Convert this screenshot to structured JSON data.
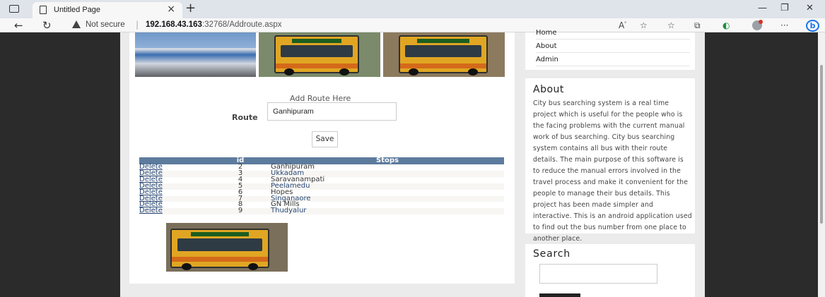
{
  "browser": {
    "tab_title": "Untitled Page",
    "tab_close": "×",
    "new_tab": "+",
    "not_secure": "Not secure",
    "separator": "|",
    "url_host": "192.168.43.163",
    "url_path": ":32768/Addroute.aspx"
  },
  "menu": {
    "items": [
      {
        "label": "Home"
      },
      {
        "label": "About"
      },
      {
        "label": "Admin"
      }
    ]
  },
  "form": {
    "title": "Add Route Here",
    "route_label": "Route",
    "route_value": "Ganhipuram",
    "save_label": "Save"
  },
  "grid": {
    "columns": [
      "",
      "id",
      "Stops"
    ],
    "delete_label": "Delete",
    "rows": [
      {
        "id": "2",
        "stop": "Ganhipuram"
      },
      {
        "id": "3",
        "stop": "Ukkadam"
      },
      {
        "id": "4",
        "stop": "Saravanampati"
      },
      {
        "id": "5",
        "stop": "Peelamedu"
      },
      {
        "id": "6",
        "stop": "Hopes"
      },
      {
        "id": "7",
        "stop": "Singanaore"
      },
      {
        "id": "8",
        "stop": "GN Mills"
      },
      {
        "id": "9",
        "stop": "Thudyalur"
      }
    ]
  },
  "about": {
    "title": "About",
    "text": "City bus searching system is a real time project which is useful for the people who is the facing problems with the current manual work of bus searching. City bus searching system contains all bus with their route details. The main purpose of this software is to reduce the manual errors involved in the travel process and make it convenient for the people to manage their bus details. This project has been made simpler and interactive. This is an android application used to find out the bus number from one place to another place."
  },
  "search": {
    "title": "Search"
  }
}
